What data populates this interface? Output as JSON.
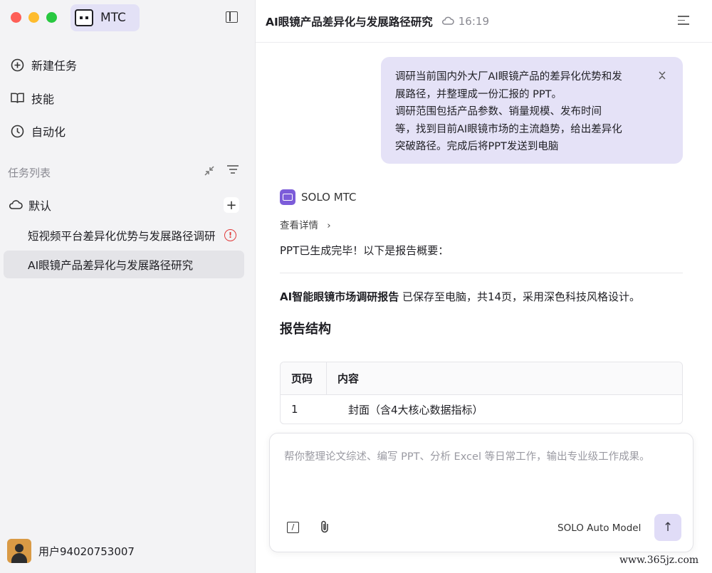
{
  "brand": {
    "name": "MTC"
  },
  "nav": [
    {
      "label": "新建任务",
      "icon": "plus-circle-icon"
    },
    {
      "label": "技能",
      "icon": "book-icon"
    },
    {
      "label": "自动化",
      "icon": "clock-icon"
    }
  ],
  "tasks_section": {
    "label": "任务列表"
  },
  "group": {
    "label": "默认",
    "add": "+"
  },
  "tasks": [
    {
      "label": "短视频平台差异化优势与发展路径调研",
      "status": "warning"
    },
    {
      "label": "AI眼镜产品差异化与发展路径研究",
      "status": "active"
    }
  ],
  "user": {
    "name": "用户94020753007"
  },
  "header": {
    "title": "AI眼镜产品差异化与发展路径研究",
    "time": "16:19"
  },
  "user_message": {
    "lines": [
      "调研当前国内外大厂AI眼镜产品的差异化优势和发",
      "展路径，并整理成一份汇报的 PPT。",
      "调研范围包括产品参数、销量规模、发布时间",
      "等，找到目前AI眼镜市场的主流趋势，给出差异化",
      "突破路径。完成后将PPT发送到电脑"
    ],
    "toggle": "⌄"
  },
  "agent": {
    "name": "SOLO MTC",
    "details_label": "查看详情",
    "details_chevron": "›",
    "intro": "PPT已生成完毕！以下是报告概要：",
    "summary_bold": "AI智能眼镜市场调研报告",
    "summary_rest": " 已保存至电脑，共14页，采用深色科技风格设计。",
    "structure_heading": "报告结构",
    "table": {
      "headers": [
        "页码",
        "内容"
      ],
      "rows": [
        [
          "1",
          "封面（含4大核心数据指标）"
        ]
      ]
    }
  },
  "composer": {
    "placeholder": "帮你整理论文综述、编写 PPT、分析 Excel 等日常工作，输出专业级工作成果。",
    "model": "SOLO Auto Model",
    "send": "↑"
  },
  "watermark": "www.365jz.com",
  "colors": {
    "accent": "#e5e2f7",
    "agent_logo": "#7c5cd9",
    "warning": "#e03b3b"
  }
}
